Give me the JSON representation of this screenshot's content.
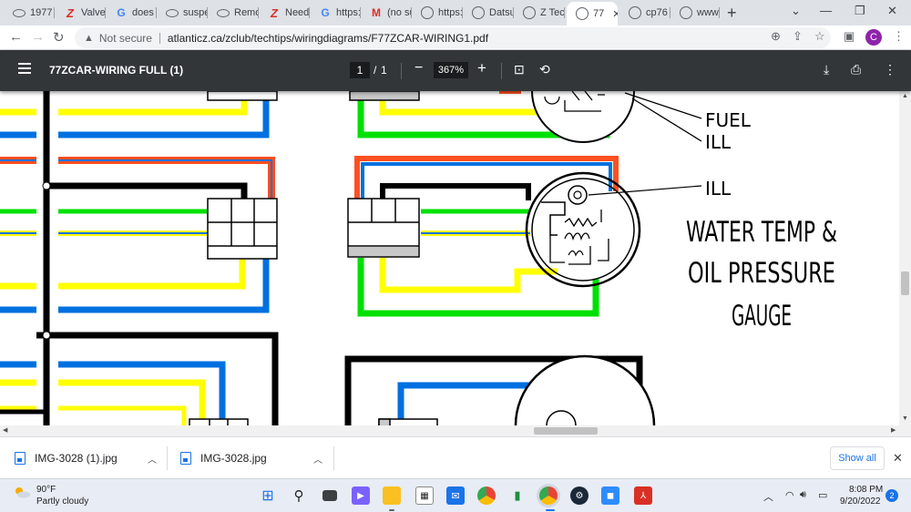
{
  "browser": {
    "tabs": [
      {
        "title": "1977",
        "icon": "oval-logo-icon"
      },
      {
        "title": "Valve",
        "icon": "z-logo-icon"
      },
      {
        "title": "does",
        "icon": "google-icon"
      },
      {
        "title": "suspe",
        "icon": "oval-logo-icon"
      },
      {
        "title": "Remo",
        "icon": "oval-logo-icon"
      },
      {
        "title": "Need",
        "icon": "z-logo-icon"
      },
      {
        "title": "https:",
        "icon": "google-icon"
      },
      {
        "title": "(no su",
        "icon": "gmail-icon"
      },
      {
        "title": "https:",
        "icon": "globe-icon"
      },
      {
        "title": "Datsu",
        "icon": "globe-icon"
      },
      {
        "title": "Z Tech",
        "icon": "globe-icon"
      },
      {
        "title": "77",
        "icon": "globe-icon",
        "active": true
      },
      {
        "title": "cp76",
        "icon": "globe-icon"
      },
      {
        "title": "www.",
        "icon": "globe-icon"
      }
    ],
    "security_label": "Not secure",
    "url": "atlanticz.ca/zclub/techtips/wiringdiagrams/F77ZCAR-WIRING1.pdf",
    "profile_initial": "C"
  },
  "pdf": {
    "title": "77ZCAR-WIRING FULL (1)",
    "page_current": "1",
    "page_separator": "/",
    "page_total": "1",
    "zoom": "367%"
  },
  "diagram": {
    "label_fuel": "FUEL",
    "label_ill_1": "ILL",
    "label_ill_2": "ILL",
    "gauge_line1": "WATER TEMP &",
    "gauge_line2": "OIL PRESSURE",
    "gauge_line3": "GAUGE"
  },
  "downloads": {
    "items": [
      {
        "filename": "IMG-3028 (1).jpg"
      },
      {
        "filename": "IMG-3028.jpg"
      }
    ],
    "show_all": "Show all"
  },
  "taskbar": {
    "weather_temp": "90°F",
    "weather_desc": "Partly cloudy",
    "time": "8:08 PM",
    "date": "9/20/2022",
    "notifications": "2"
  },
  "colors": {
    "wire_yellow": "#ffff00",
    "wire_blue": "#0070e0",
    "wire_green": "#00e000",
    "wire_orange": "#ff5020",
    "wire_black": "#000000",
    "pdf_toolbar": "#323639"
  }
}
